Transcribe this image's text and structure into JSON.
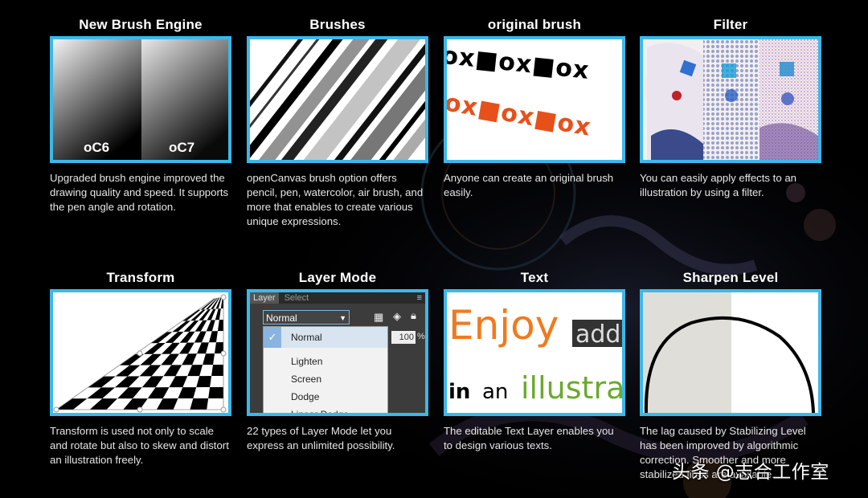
{
  "cards": [
    {
      "title": "New Brush Engine",
      "desc": "Upgraded brush engine improved the drawing quality and speed. It supports the pen angle and rotation.",
      "labels": [
        "oC6",
        "oC7"
      ]
    },
    {
      "title": "Brushes",
      "desc": "openCanvas brush option offers pencil, pen, watercolor, air brush, and more that enables to create various unique expressions."
    },
    {
      "title": "original brush",
      "desc": "Anyone can create an original brush easily.",
      "pattern_text": "ox■ox■ox"
    },
    {
      "title": "Filter",
      "desc": "You can easily apply effects to an illustration by using a filter."
    },
    {
      "title": "Transform",
      "desc": "Transform is used not only to scale and rotate but also to skew and distort an illustration freely."
    },
    {
      "title": "Layer Mode",
      "desc": "22 types of Layer Mode let you express an unlimited possibility.",
      "panel": {
        "tabs": [
          "Layer",
          "Select"
        ],
        "selected": "Normal",
        "opacity": "100",
        "percent": "%",
        "options": [
          "Normal",
          "Lighten",
          "Screen",
          "Dodge",
          "Linear Dodge"
        ]
      }
    },
    {
      "title": "Text",
      "desc": "The editable Text Layer enables you to design various texts.",
      "sample": {
        "word1": "Enjoy",
        "word2": "add",
        "line2a": "in",
        "line2b": "an",
        "line2c": "illustrat"
      }
    },
    {
      "title": "Sharpen Level",
      "desc": "The lag caused by Stabilizing Level has been improved by algorithmic correction. Smoother and more stabilized lines are available."
    }
  ],
  "watermark": "头条 @志合工作室",
  "colors": {
    "accent_border": "#3bb8ea",
    "background": "#000000",
    "brush_orange": "#e8501a",
    "text_orange": "#f07a1e",
    "text_green": "#6aaa2e"
  }
}
